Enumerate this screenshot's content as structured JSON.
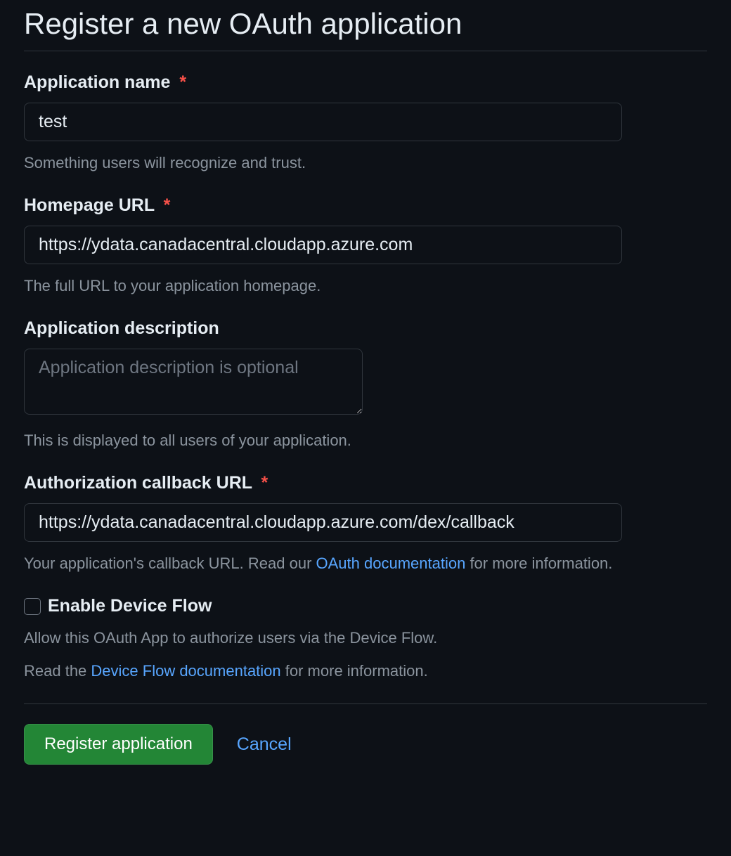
{
  "page": {
    "title": "Register a new OAuth application"
  },
  "fields": {
    "app_name": {
      "label": "Application name",
      "value": "test",
      "help": "Something users will recognize and trust.",
      "required": true
    },
    "homepage_url": {
      "label": "Homepage URL",
      "value": "https://ydata.canadacentral.cloudapp.azure.com",
      "help": "The full URL to your application homepage.",
      "required": true
    },
    "description": {
      "label": "Application description",
      "placeholder": "Application description is optional",
      "value": "",
      "help": "This is displayed to all users of your application.",
      "required": false
    },
    "callback_url": {
      "label": "Authorization callback URL",
      "value": "https://ydata.canadacentral.cloudapp.azure.com/dex/callback",
      "help_before_link": "Your application's callback URL. Read our ",
      "help_link_text": "OAuth documentation",
      "help_after_link": " for more information.",
      "required": true
    },
    "device_flow": {
      "label": "Enable Device Flow",
      "checked": false,
      "help1": "Allow this OAuth App to authorize users via the Device Flow.",
      "help2_before_link": "Read the ",
      "help2_link_text": "Device Flow documentation",
      "help2_after_link": " for more information."
    }
  },
  "actions": {
    "register": "Register application",
    "cancel": "Cancel"
  },
  "required_asterisk": "*"
}
